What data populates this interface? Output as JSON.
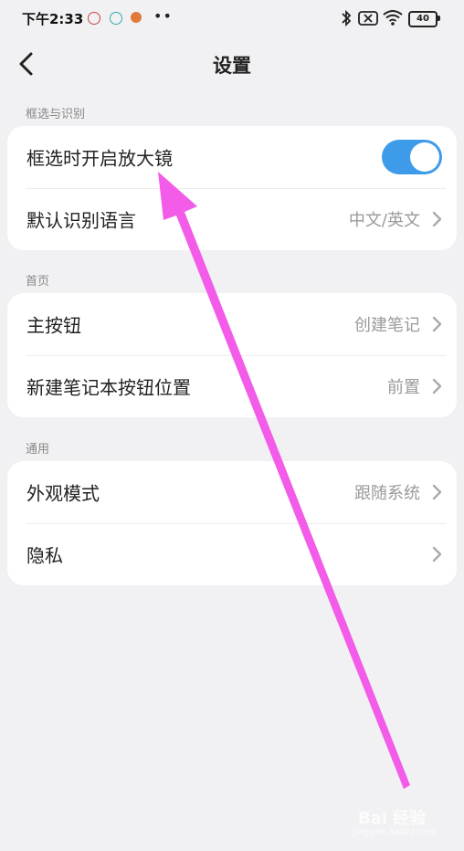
{
  "status_bar": {
    "time": "下午2:33",
    "dots": "••",
    "battery": "40"
  },
  "header": {
    "title": "设置"
  },
  "sections": [
    {
      "label": "框选与识别",
      "rows": [
        {
          "label": "框选时开启放大镜",
          "toggle_on": true
        },
        {
          "label": "默认识别语言",
          "value": "中文/英文"
        }
      ]
    },
    {
      "label": "首页",
      "rows": [
        {
          "label": "主按钮",
          "value": "创建笔记"
        },
        {
          "label": "新建笔记本按钮位置",
          "value": "前置"
        }
      ]
    },
    {
      "label": "通用",
      "rows": [
        {
          "label": "外观模式",
          "value": "跟随系统"
        },
        {
          "label": "隐私",
          "value": ""
        }
      ]
    }
  ],
  "colors": {
    "toggle_on": "#3d9be9",
    "annotation_arrow": "#f25ce8",
    "background": "#f1f1f3"
  },
  "watermark": {
    "brand": "Bai 经验",
    "url": "jingyan.baidu.com"
  }
}
